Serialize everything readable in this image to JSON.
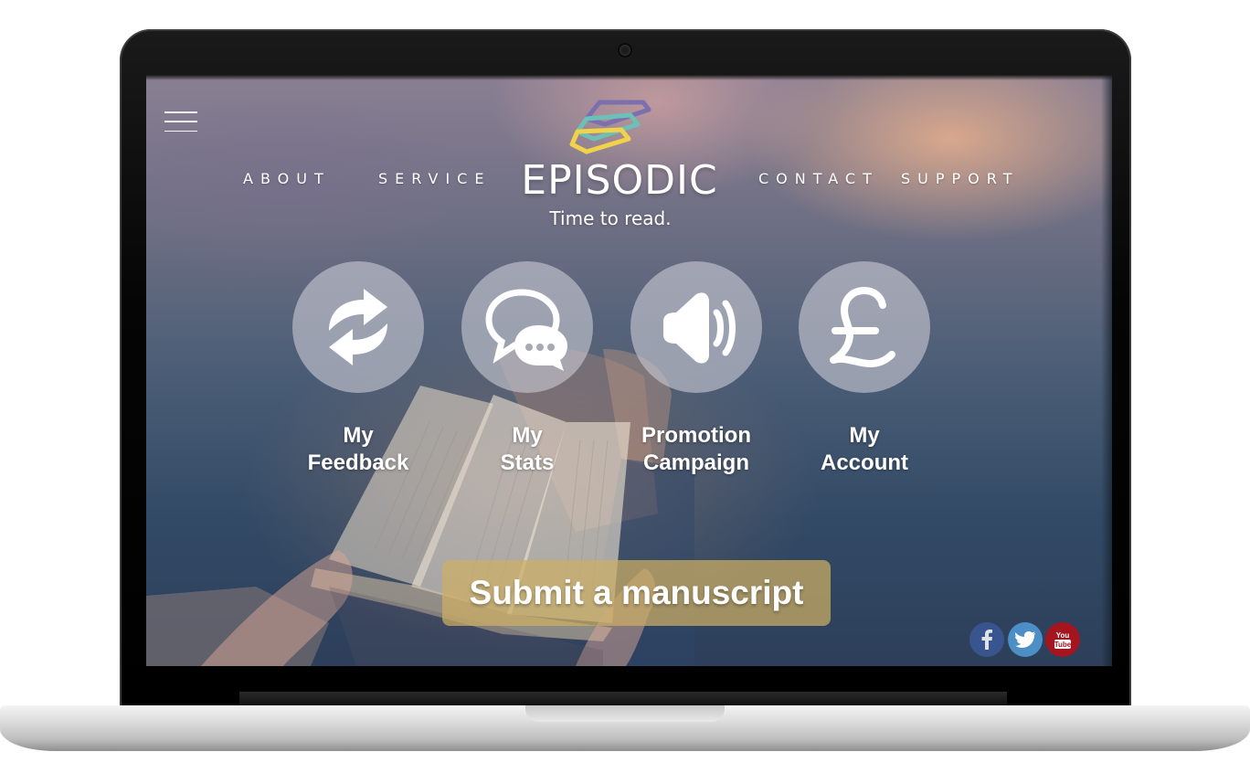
{
  "nav": {
    "links": [
      "ABOUT",
      "SERVICE",
      "CONTACT",
      "SUPPORT"
    ]
  },
  "brand": {
    "name": "EPISODIC",
    "tagline": "Time to read.",
    "logo_colors": [
      "#7b6fb0",
      "#6cc0b8",
      "#f0d34a"
    ]
  },
  "features": [
    {
      "line1": "My",
      "line2": "Feedback",
      "icon": "refresh-icon"
    },
    {
      "line1": "My",
      "line2": "Stats",
      "icon": "chat-bubbles-icon"
    },
    {
      "line1": "Promotion",
      "line2": "Campaign",
      "icon": "speaker-icon"
    },
    {
      "line1": "My",
      "line2": "Account",
      "icon": "pound-icon"
    }
  ],
  "cta": {
    "label": "Submit a manuscript"
  },
  "social": {
    "youtube_label": "You Tube",
    "icons": [
      "facebook-icon",
      "twitter-icon",
      "youtube-icon"
    ]
  },
  "colors": {
    "cta_bg": "#cdaf64",
    "facebook": "#3b5998",
    "twitter": "#4c8fc6",
    "youtube": "#a41520"
  }
}
